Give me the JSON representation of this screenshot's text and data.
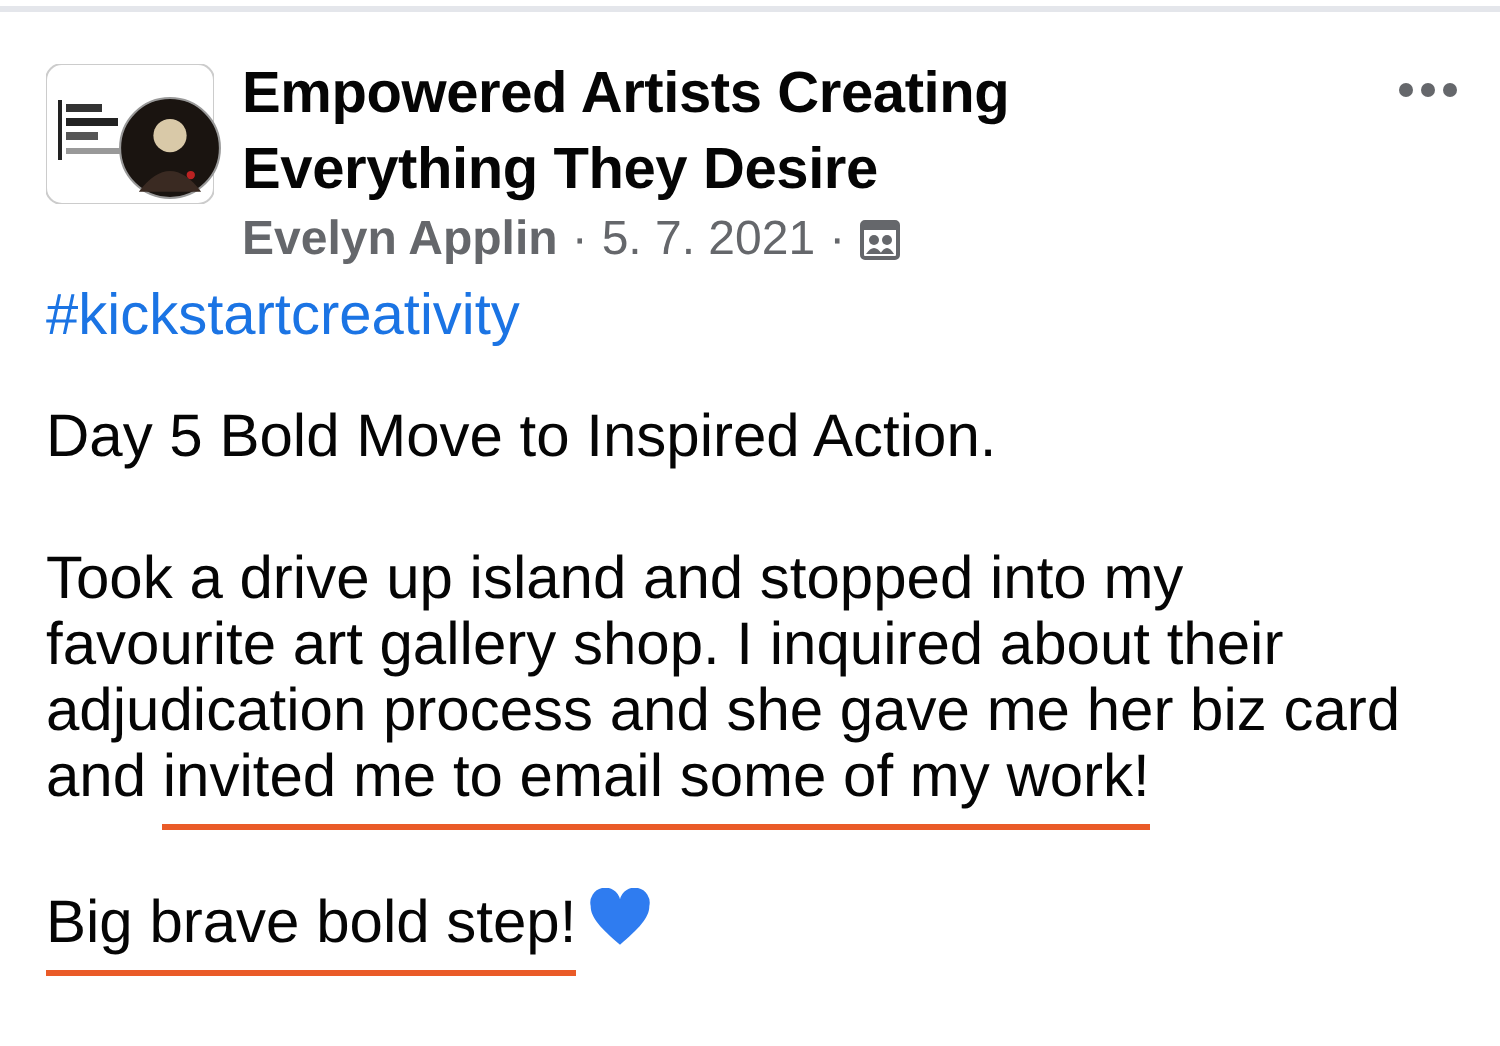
{
  "post": {
    "group_name": "Empowered Artists Creating Everything They Desire",
    "author": "Evelyn Applin",
    "separator_1": "·",
    "date": "5. 7. 2021",
    "separator_2": "·",
    "hashtag": "#kickstartcreativity",
    "paragraphs": [
      [
        {
          "text": "Day 5 Bold Move to Inspired Action.",
          "underlined": false
        }
      ],
      [
        {
          "text": "Took a drive up island and stopped into my favourite art gallery shop. I inquired about their adjudication process and she gave me her biz card and ",
          "underlined": false
        },
        {
          "text": "invited me to email some of my work!",
          "underlined": true
        }
      ],
      [
        {
          "text": "Big brave bold step!",
          "underlined": true
        }
      ]
    ]
  }
}
